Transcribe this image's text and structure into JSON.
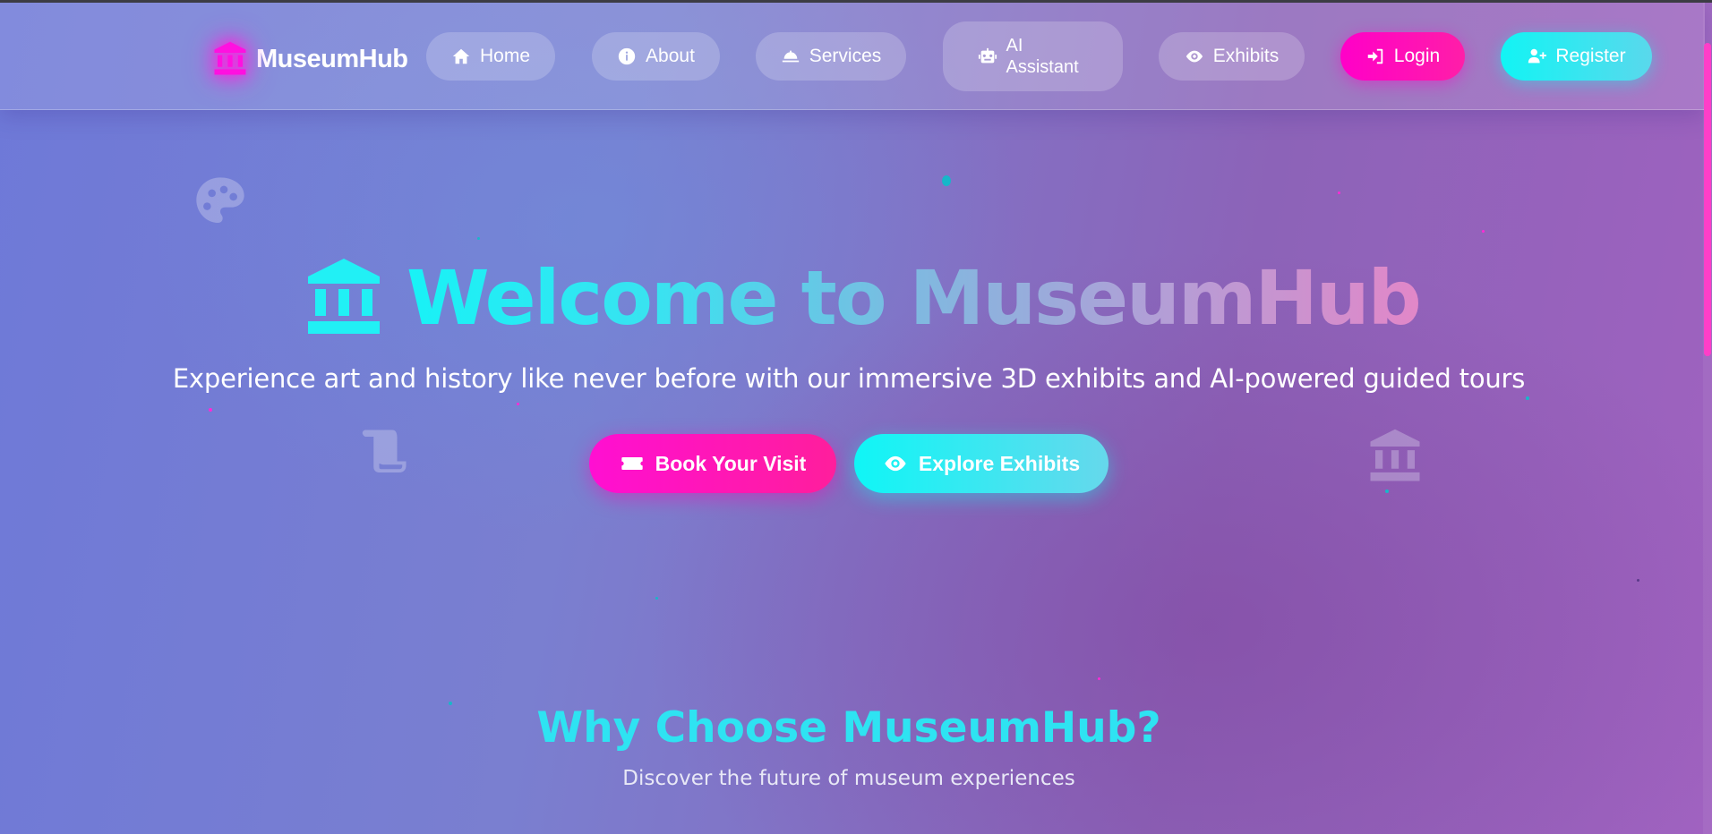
{
  "brand": {
    "name": "MuseumHub",
    "icon": "landmark-icon",
    "icon_color": "#ff1ee0"
  },
  "nav": {
    "items": [
      {
        "label": "Home",
        "icon": "home-icon"
      },
      {
        "label": "About",
        "icon": "info-circle-icon"
      },
      {
        "label": "Services",
        "icon": "concierge-bell-icon"
      },
      {
        "label": "AI Assistant",
        "line1": "AI",
        "line2": "Assistant",
        "icon": "robot-icon"
      },
      {
        "label": "Exhibits",
        "icon": "eye-icon"
      }
    ],
    "login": {
      "label": "Login",
      "icon": "sign-in-icon",
      "color": "#ff00c8"
    },
    "register": {
      "label": "Register",
      "icon": "user-plus-icon",
      "color": "#12f4f4"
    }
  },
  "hero": {
    "title": "Welcome to MuseumHub",
    "title_icon": "landmark-icon",
    "subtitle": "Experience art and history like never before with our immersive 3D exhibits and AI-powered guided tours",
    "book_button": {
      "label": "Book Your Visit",
      "icon": "ticket-icon",
      "color": "#ff0fd2"
    },
    "explore_button": {
      "label": "Explore Exhibits",
      "icon": "eye-icon",
      "color": "#0ff6f6"
    },
    "decorations": [
      "palette-icon",
      "scroll-icon",
      "landmark-icon"
    ]
  },
  "features": {
    "title": "Why Choose MuseumHub?",
    "subtitle": "Discover the future of museum experiences"
  },
  "colors": {
    "accent_magenta": "#ff00c8",
    "accent_cyan": "#12f4f4",
    "title_cyan": "#2ee3f2"
  }
}
